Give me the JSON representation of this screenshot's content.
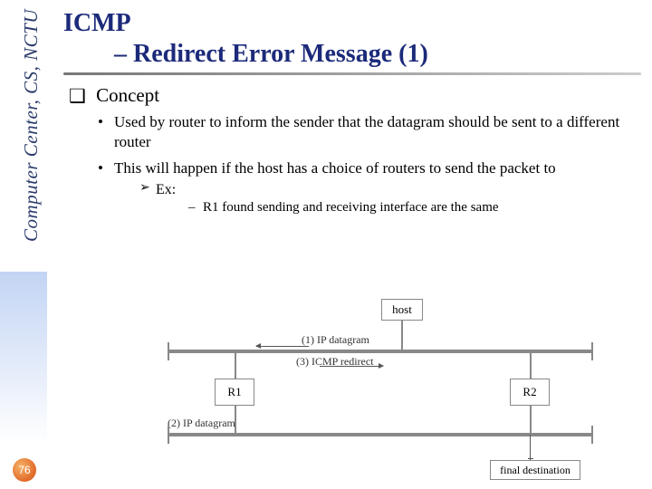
{
  "sidebar": {
    "text": "Computer Center, CS, NCTU"
  },
  "page_number": "76",
  "title": {
    "line1": "ICMP",
    "line2": "– Redirect Error Message (1)"
  },
  "section": {
    "heading": "Concept"
  },
  "bullets": {
    "b1": "Used by router to inform the sender that the datagram should be sent to a different router",
    "b2": "This will happen if the host has a choice of routers to send the packet to",
    "ex_label": "Ex:",
    "ex_detail": "R1 found sending and receiving interface are the same"
  },
  "diagram": {
    "host": "host",
    "r1": "R1",
    "r2": "R2",
    "final": "final destination",
    "l1": "(1) IP datagram",
    "l2": "(2) IP datagram",
    "l3": "(3) ICMP redirect"
  }
}
